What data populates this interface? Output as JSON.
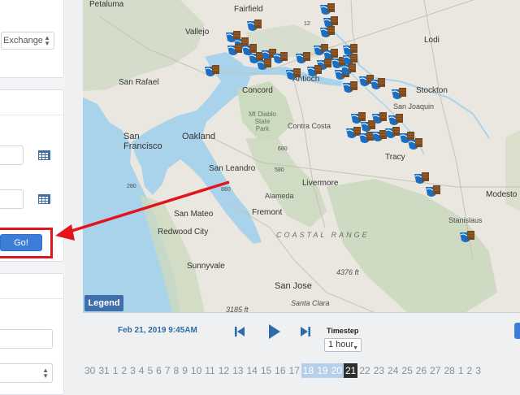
{
  "sidebar": {
    "exchange_select": "Exchange",
    "go_button": "Go!",
    "start_date_value": "",
    "end_date_value": "",
    "bottom_input_value": "",
    "bottom_select_value": ""
  },
  "map": {
    "legend_button": "Legend",
    "labels": {
      "petaluma": "Petaluma",
      "fairfield": "Fairfield",
      "vallejo": "Vallejo",
      "lodi": "Lodi",
      "san_rafael": "San Rafael",
      "stockton": "Stockton",
      "concord": "Concord",
      "antioch": "Antioch",
      "mt_diablo": "Mt Diablo State Park",
      "contra_costa": "Contra Costa",
      "san_joaquin": "San Joaquin",
      "san_francisco": "San Francisco",
      "oakland": "Oakland",
      "san_leandro": "San Leandro",
      "tracy": "Tracy",
      "livermore": "Livermore",
      "alameda": "Alameda",
      "modesto": "Modesto",
      "san_mateo": "San Mateo",
      "fremont": "Fremont",
      "stanislaus": "Stanislaus",
      "redwood_city": "Redwood City",
      "coastal_range": "COASTAL RANGE",
      "sunnyvale": "Sunnyvale",
      "peak_4376": "4376 ft",
      "san_jose": "San Jose",
      "santa_clara": "Santa Clara",
      "peak_3185": "3185 ft",
      "road_12": "12",
      "road_580": "580",
      "road_880": "880",
      "road_680": "680",
      "road_280": "280"
    }
  },
  "timeline": {
    "current_datetime": "Feb 21, 2019 9:45AM",
    "timestep_label": "Timestep",
    "timestep_value": "1 hour",
    "days": [
      "30",
      "31",
      "1",
      "2",
      "3",
      "4",
      "5",
      "6",
      "7",
      "8",
      "9",
      "10",
      "11",
      "12",
      "13",
      "14",
      "15",
      "16",
      "17",
      "18",
      "19",
      "20",
      "21",
      "22",
      "23",
      "24",
      "25",
      "26",
      "27",
      "28",
      "1",
      "2",
      "3"
    ],
    "selected_days": [
      "18",
      "19",
      "20"
    ],
    "current_day": "21"
  },
  "colors": {
    "accent": "#3b7dd8",
    "annotation_red": "#e3141c",
    "marker_blue": "#1a6fc4",
    "marker_brown": "#7a4a1e",
    "land": "#e8e6df",
    "water": "#a9d3ea",
    "hills": "#c9d8bc"
  }
}
